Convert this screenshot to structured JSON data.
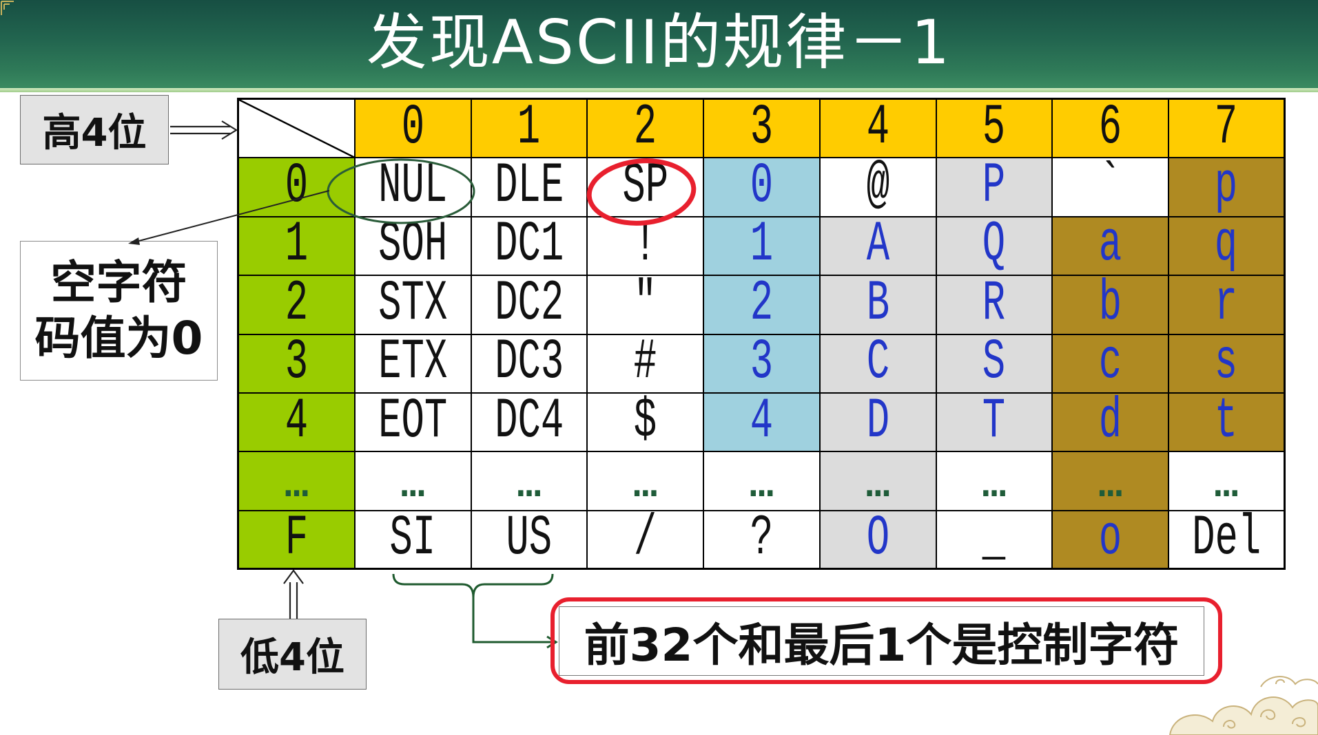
{
  "title": "发现ASCII的规律－1",
  "annotations": {
    "high_bits_label": "高4位",
    "low_bits_label": "低4位",
    "null_char_note": [
      "空字符",
      "码值为0"
    ],
    "control_char_note": "前32个和最后1个是控制字符"
  },
  "table": {
    "column_headers": [
      "0",
      "1",
      "2",
      "3",
      "4",
      "5",
      "6",
      "7"
    ],
    "rows": [
      {
        "header": "0",
        "cells": [
          "NUL",
          "DLE",
          "SP",
          "0",
          "@",
          "P",
          "`",
          "p"
        ],
        "fills": [
          "white",
          "white",
          "white",
          "blue",
          "white",
          "gray",
          "white",
          "brown"
        ],
        "ink": [
          "black",
          "black",
          "black",
          "blue",
          "black",
          "blue",
          "black",
          "blue"
        ]
      },
      {
        "header": "1",
        "cells": [
          "SOH",
          "DC1",
          "!",
          "1",
          "A",
          "Q",
          "a",
          "q"
        ],
        "fills": [
          "white",
          "white",
          "white",
          "blue",
          "gray",
          "gray",
          "brown",
          "brown"
        ],
        "ink": [
          "black",
          "black",
          "black",
          "blue",
          "blue",
          "blue",
          "blue",
          "blue"
        ]
      },
      {
        "header": "2",
        "cells": [
          "STX",
          "DC2",
          "\"",
          "2",
          "B",
          "R",
          "b",
          "r"
        ],
        "fills": [
          "white",
          "white",
          "white",
          "blue",
          "gray",
          "gray",
          "brown",
          "brown"
        ],
        "ink": [
          "black",
          "black",
          "black",
          "blue",
          "blue",
          "blue",
          "blue",
          "blue"
        ]
      },
      {
        "header": "3",
        "cells": [
          "ETX",
          "DC3",
          "#",
          "3",
          "C",
          "S",
          "c",
          "s"
        ],
        "fills": [
          "white",
          "white",
          "white",
          "blue",
          "gray",
          "gray",
          "brown",
          "brown"
        ],
        "ink": [
          "black",
          "black",
          "black",
          "blue",
          "blue",
          "blue",
          "blue",
          "blue"
        ]
      },
      {
        "header": "4",
        "cells": [
          "EOT",
          "DC4",
          "$",
          "4",
          "D",
          "T",
          "d",
          "t"
        ],
        "fills": [
          "white",
          "white",
          "white",
          "blue",
          "gray",
          "gray",
          "brown",
          "brown"
        ],
        "ink": [
          "black",
          "black",
          "black",
          "blue",
          "blue",
          "blue",
          "blue",
          "blue"
        ]
      },
      {
        "header": "…",
        "cells": [
          "…",
          "…",
          "…",
          "…",
          "…",
          "…",
          "…",
          "…"
        ],
        "fills": [
          "white",
          "white",
          "white",
          "white",
          "gray",
          "white",
          "brown",
          "white"
        ],
        "ink": [
          "green",
          "green",
          "green",
          "green",
          "green",
          "green",
          "green",
          "green"
        ]
      },
      {
        "header": "F",
        "cells": [
          "SI",
          "US",
          "/",
          "?",
          "O",
          "_",
          "o",
          "Del"
        ],
        "fills": [
          "white",
          "white",
          "white",
          "white",
          "gray",
          "white",
          "brown",
          "white"
        ],
        "ink": [
          "black",
          "black",
          "black",
          "black",
          "blue",
          "black",
          "blue",
          "black"
        ]
      }
    ]
  },
  "colors": {
    "column_header_fill": "#ffcc00",
    "row_header_fill": "#99cc00",
    "fills": {
      "white": "#ffffff",
      "blue": "#9fd1df",
      "gray": "#dcdcdc",
      "brown": "#af8a22"
    },
    "ink": {
      "black": "#111111",
      "blue": "#2236c8",
      "green": "#1f5c39"
    },
    "highlight_red": "#e8202e",
    "highlight_green": "#2a5c39"
  }
}
